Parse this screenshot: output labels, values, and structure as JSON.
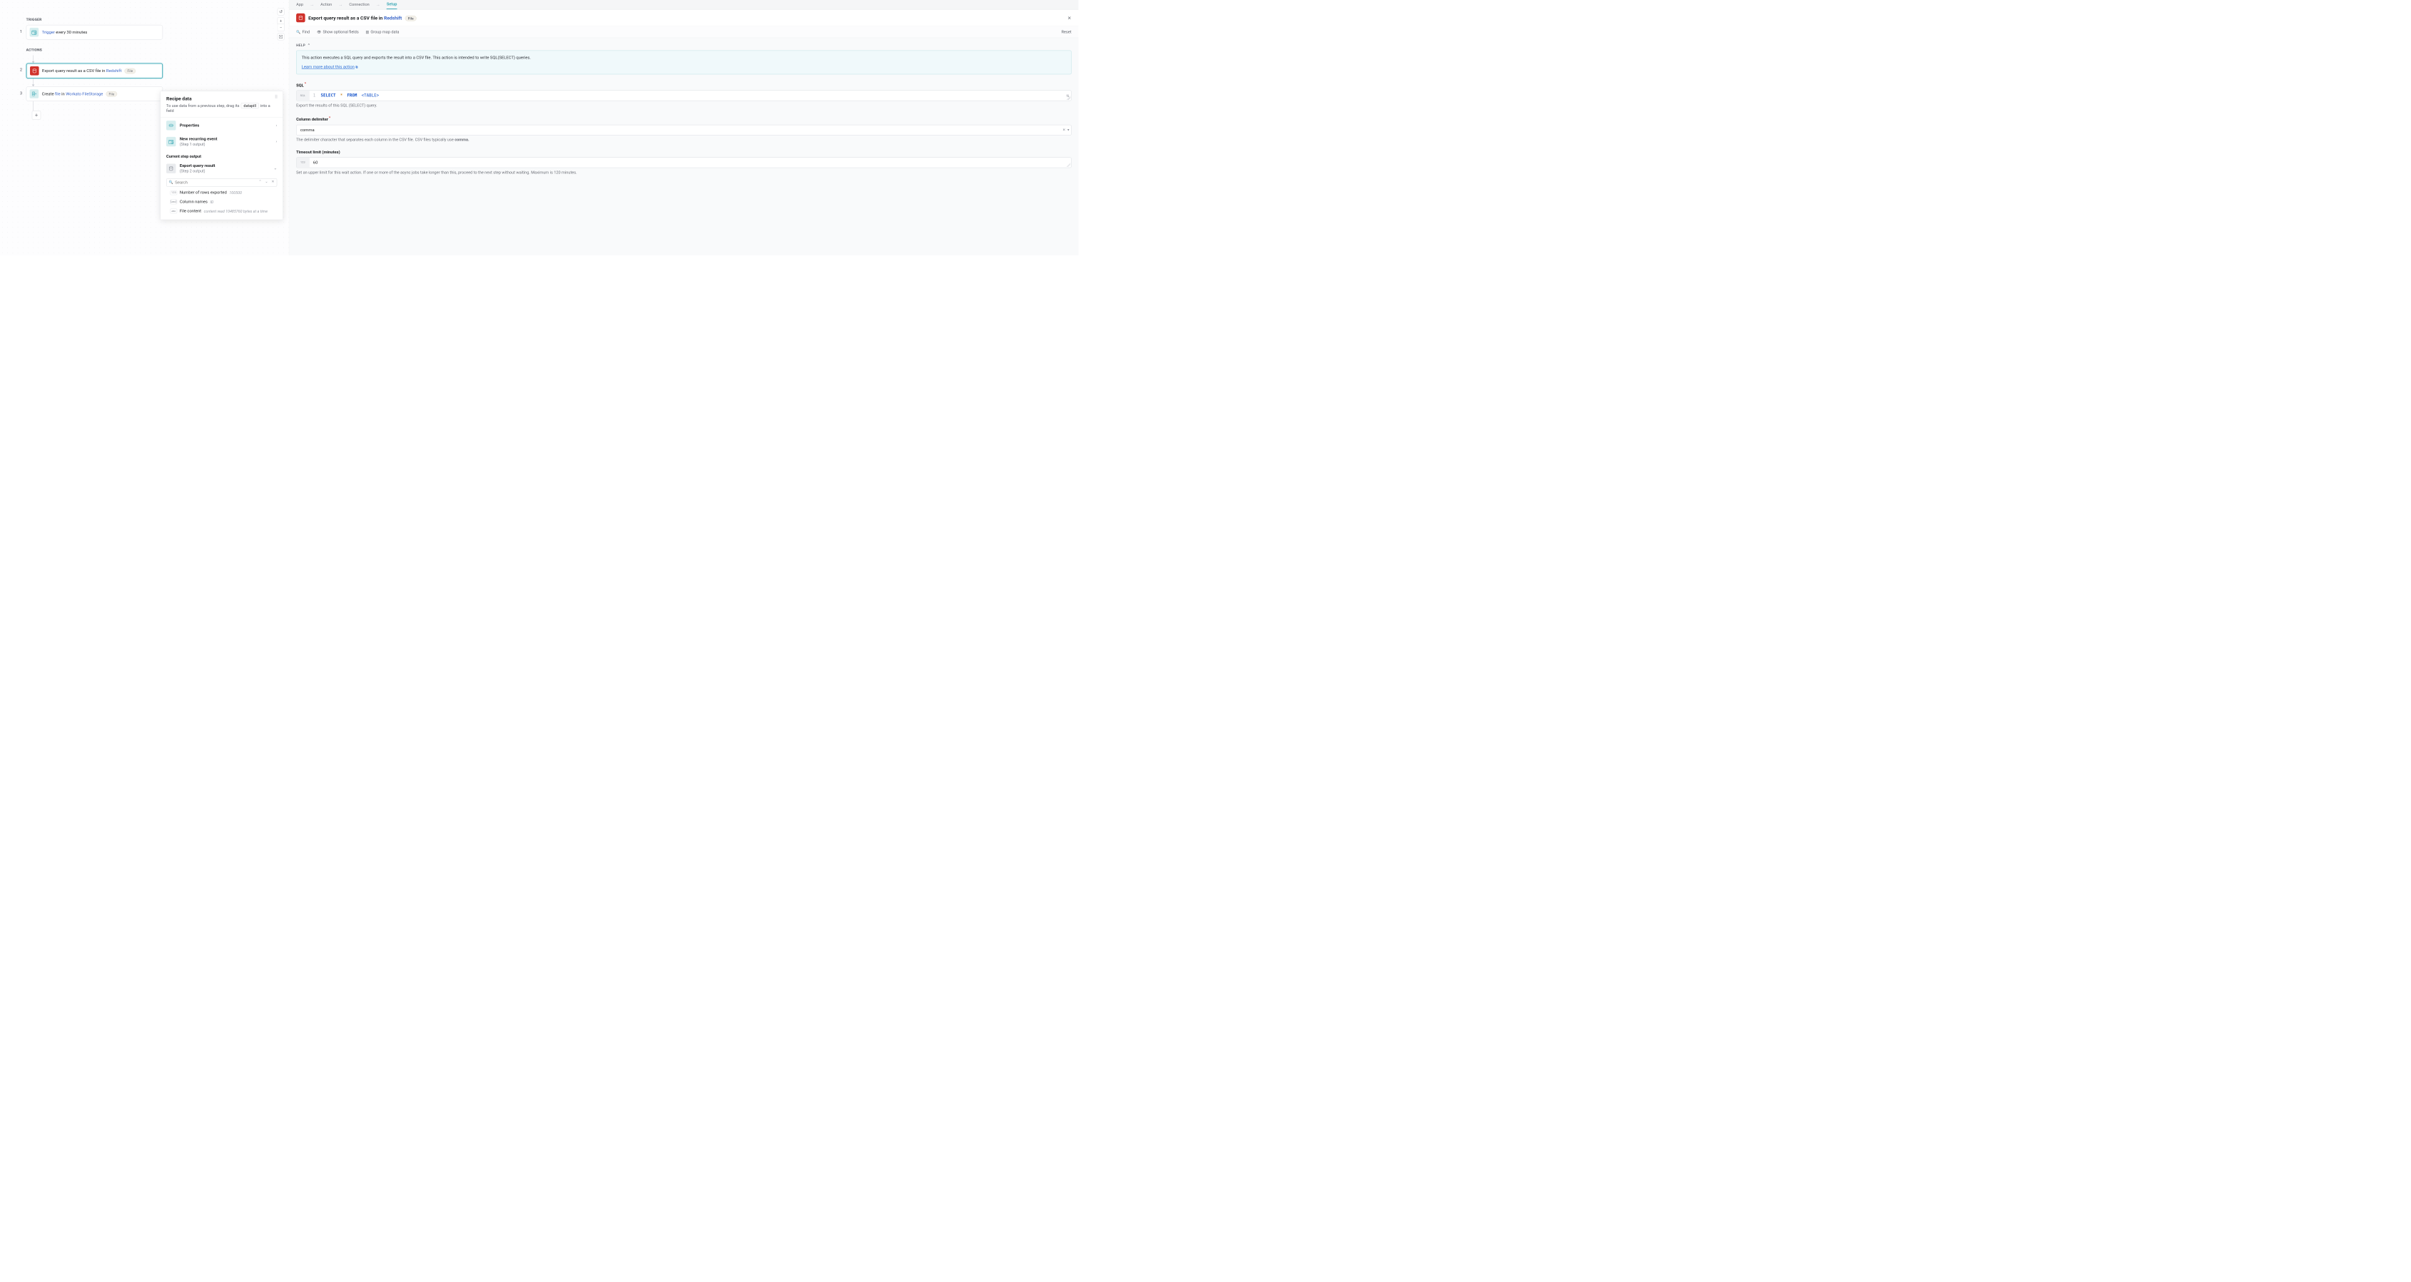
{
  "canvas": {
    "trigger_label": "TRIGGER",
    "actions_label": "ACTIONS",
    "steps": {
      "s1": {
        "num": "1",
        "kw": "Trigger",
        "rest": " every 30 minutes"
      },
      "s2": {
        "num": "2",
        "pre": "Export query result as a CSV file in ",
        "app": "Redshift",
        "pill": "File"
      },
      "s3": {
        "num": "3",
        "pre": "Create ",
        "obj": "file",
        "mid": " in ",
        "app": "Workato FileStorage",
        "pill": "File"
      }
    }
  },
  "recipe": {
    "title": "Recipe data",
    "sub_pre": "To use data from a previous step, drag its ",
    "chip": "datapill",
    "sub_post": " into a field",
    "props_label": "Properties",
    "evt_title": "New recurring event",
    "evt_sub": "(Step 1 output)",
    "current_label": "Current step output",
    "cur_title": "Export query result",
    "cur_sub": "(Step 2 output)",
    "search_placeholder": "Search",
    "pills": {
      "p1": {
        "type": "123",
        "name": "Number of rows exported",
        "ex": "100500"
      },
      "p2": {
        "type": "[ᴀʙᴄ]",
        "name": "Column names",
        "ex": "ID"
      },
      "p3": {
        "type": "ᴀʙᴄ",
        "name": "File content",
        "ex": "content read 10485760 bytes at a time"
      }
    }
  },
  "tabs": {
    "app": "App",
    "action": "Action",
    "conn": "Connection",
    "setup": "Setup"
  },
  "title": {
    "pre": "Export query result as a CSV file in ",
    "app": "Redshift",
    "pill": "File"
  },
  "toolbar": {
    "find": "Find",
    "optional": "Show optional fields",
    "group": "Group map data",
    "reset": "Reset"
  },
  "help": {
    "head": "HELP",
    "body": "This action executes a SQL query and exports the result into a CSV file. This action is intended to write SQL(SELECT) queries.",
    "link": "Learn more about this action"
  },
  "fields": {
    "sql": {
      "label": "SQL",
      "code_select": "SELECT",
      "code_star": "*",
      "code_from": "FROM",
      "code_table": "<TABLE>",
      "help": "Export the results of this SQL (SELECT) query."
    },
    "delim": {
      "label": "Column delimiter",
      "value": "comma",
      "help_pre": "The delimiter character that separates each column in the CSV file. CSV files typically use ",
      "help_bold": "comma."
    },
    "timeout": {
      "label": "Timeout limit (minutes)",
      "value": "60",
      "help": "Set an upper limit for this wait action. If one or more of the async jobs take longer than this, proceed to the next step without waiting. Maximum is 120 minutes."
    }
  }
}
